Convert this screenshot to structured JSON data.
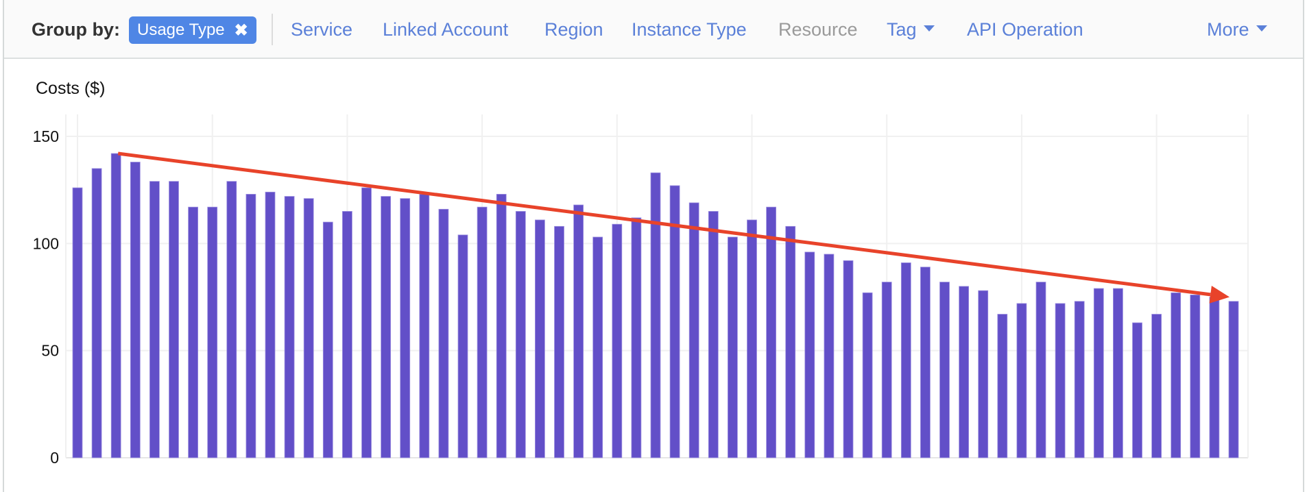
{
  "toolbar": {
    "group_by_label": "Group by:",
    "active_chip": {
      "label": "Usage Type",
      "remove_icon": "close-icon"
    },
    "tabs": [
      {
        "label": "Service",
        "enabled": true,
        "dropdown": false
      },
      {
        "label": "Linked Account",
        "enabled": true,
        "dropdown": false
      },
      {
        "label": "Region",
        "enabled": true,
        "dropdown": false
      },
      {
        "label": "Instance Type",
        "enabled": true,
        "dropdown": false
      },
      {
        "label": "Resource",
        "enabled": false,
        "dropdown": false
      },
      {
        "label": "Tag",
        "enabled": true,
        "dropdown": true
      },
      {
        "label": "API Operation",
        "enabled": true,
        "dropdown": false
      }
    ],
    "more": {
      "label": "More",
      "dropdown": true
    }
  },
  "colors": {
    "accent": "#4f86e5",
    "link": "#5b80d8",
    "bar": "#624fc8",
    "trend_arrow": "#e8432a",
    "grid": "#f0f0f0"
  },
  "chart_data": {
    "type": "bar",
    "title": "Costs ($)",
    "xlabel": "",
    "ylabel": "Costs ($)",
    "ylim": [
      0,
      160
    ],
    "yticks": [
      0,
      50,
      100,
      150
    ],
    "grid": true,
    "legend": "none",
    "categories_count": 61,
    "series": [
      {
        "name": "Costs",
        "values": [
          126,
          135,
          142,
          138,
          129,
          129,
          117,
          117,
          129,
          123,
          124,
          122,
          121,
          110,
          115,
          126,
          122,
          121,
          123,
          116,
          104,
          117,
          123,
          115,
          111,
          108,
          118,
          103,
          109,
          112,
          133,
          127,
          119,
          115,
          103,
          111,
          117,
          108,
          96,
          95,
          92,
          77,
          82,
          91,
          89,
          82,
          80,
          78,
          67,
          72,
          82,
          72,
          73,
          79,
          79,
          63,
          67,
          77,
          76,
          75,
          73
        ]
      }
    ],
    "annotations": [
      {
        "type": "trend-arrow",
        "from": {
          "index": 2,
          "value": 142
        },
        "to": {
          "index": 60,
          "value": 75
        },
        "direction": "downward"
      }
    ]
  }
}
